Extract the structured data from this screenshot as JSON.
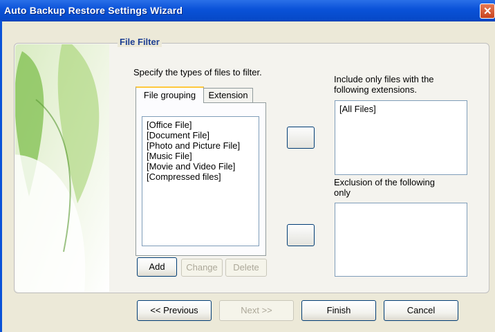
{
  "window": {
    "title": "Auto Backup Restore Settings Wizard"
  },
  "group": {
    "legend": "File Filter"
  },
  "filter": {
    "instruction": "Specify the types of files to filter.",
    "tabs": [
      "File grouping",
      "Extension"
    ],
    "file_groups": [
      "[Office File]",
      "[Document File]",
      "[Photo and Picture File]",
      "[Music File]",
      "[Movie and Video File]",
      "[Compressed files]"
    ]
  },
  "list_buttons": {
    "add": "Add",
    "change": "Change",
    "delete": "Delete"
  },
  "include": {
    "label_line1": "Include only files with the",
    "label_line2": "following extensions.",
    "items": [
      "[All Files]"
    ]
  },
  "exclude": {
    "label_line1": "Exclusion of the following",
    "label_line2": "only",
    "items": []
  },
  "nav": {
    "previous": "<< Previous",
    "next": "Next >>",
    "finish": "Finish",
    "cancel": "Cancel"
  },
  "colors": {
    "titlebar": "#0a52d8",
    "legend": "#1d3e92",
    "close": "#c8431f",
    "dialog": "#ece9d8"
  }
}
